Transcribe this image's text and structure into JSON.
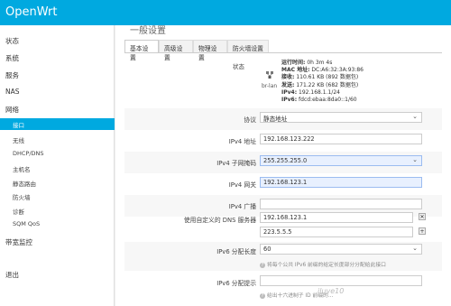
{
  "header": {
    "brand": "OpenWrt"
  },
  "sidebar": {
    "items": [
      {
        "label": "状态"
      },
      {
        "label": "系统"
      },
      {
        "label": "服务"
      },
      {
        "label": "NAS"
      },
      {
        "label": "网络"
      }
    ],
    "network_items": [
      {
        "label": "接口"
      },
      {
        "label": "无线"
      },
      {
        "label": "DHCP/DNS"
      },
      {
        "label": "主机名"
      },
      {
        "label": "静态路由"
      },
      {
        "label": "防火墙"
      },
      {
        "label": "诊断"
      },
      {
        "label": "SQM QoS"
      }
    ],
    "bandwidth": "带宽监控",
    "logout": "退出"
  },
  "main": {
    "section_title": "一般设置",
    "tabs": [
      {
        "label": "基本设置"
      },
      {
        "label": "高级设置"
      },
      {
        "label": "物理设置"
      },
      {
        "label": "防火墙设置"
      }
    ],
    "status": {
      "label": "状态",
      "iface": "br-lan",
      "uptime_k": "运行时间:",
      "uptime_v": " 0h 3m 4s",
      "mac_k": "MAC 地址:",
      "mac_v": " DC:A6:32:3A:93:86",
      "rx_k": "接收:",
      "rx_v": " 110.61 KB (892 数据包)",
      "tx_k": "发送:",
      "tx_v": " 171.22 KB (682 数据包)",
      "ipv4_k": "IPv4:",
      "ipv4_v": " 192.168.1.1/24",
      "ipv6_k": "IPv6:",
      "ipv6_v": " fdcd:ebaa:8da0::1/60"
    },
    "protocol": {
      "label": "协议",
      "value": "静态地址"
    },
    "ipv4_addr": {
      "label": "IPv4 地址",
      "value": "192.168.123.222"
    },
    "netmask": {
      "label": "IPv4 子网掩码",
      "value": "255.255.255.0"
    },
    "gateway": {
      "label": "IPv4 网关",
      "value": "192.168.123.1"
    },
    "broadcast": {
      "label": "IPv4 广播",
      "value": ""
    },
    "dns": {
      "label": "使用自定义的 DNS 服务器",
      "values": [
        "192.168.123.1",
        "223.5.5.5"
      ]
    },
    "ipv6_len": {
      "label": "IPv6 分配长度",
      "value": "60",
      "hint": "将每个公共 IPv6 前缀的给定长度部分分配给此接口"
    },
    "ipv6_hint": {
      "label": "IPv6 分配提示",
      "value": "",
      "hint": "给出十六进制子 ID 前缀的..."
    }
  },
  "watermark": "iluve10"
}
